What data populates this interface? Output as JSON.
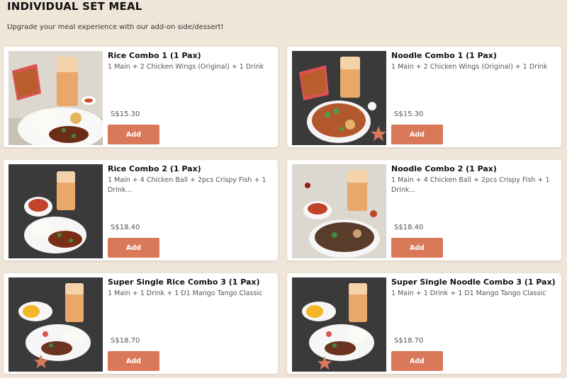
{
  "header": {
    "title": "INDIVIDUAL SET MEAL",
    "subtitle": "Upgrade your meal experience with our add-on side/dessert!"
  },
  "colors": {
    "background": "#efe6d9",
    "add_button": "#d9795a",
    "photo_dark_bg": "#3b3b3b"
  },
  "items": [
    {
      "name": "Rice Combo 1 (1 Pax)",
      "description": "1 Main + 2 Chicken Wings (Original) + 1 Drink",
      "price": "S$15.30",
      "button": "Add",
      "photo": "rice-combo-1-photo"
    },
    {
      "name": "Noodle Combo 1 (1 Pax)",
      "description": "1 Main + 2 Chicken Wings (Original) + 1 Drink",
      "price": "S$15.30",
      "button": "Add",
      "photo": "noodle-combo-1-photo"
    },
    {
      "name": "Rice Combo 2 (1 Pax)",
      "description": "1 Main + 4 Chicken Ball + 2pcs Crispy Fish + 1 Drink...",
      "price": "S$18.40",
      "button": "Add",
      "photo": "rice-combo-2-photo"
    },
    {
      "name": "Noodle Combo 2 (1 Pax)",
      "description": "1 Main + 4 Chicken Ball + 2pcs Crispy Fish + 1 Drink...",
      "price": "S$18.40",
      "button": "Add",
      "photo": "noodle-combo-2-photo"
    },
    {
      "name": "Super Single Rice Combo 3 (1 Pax)",
      "description": "1 Main + 1 Drink + 1 D1 Mango Tango Classic",
      "price": "S$18.70",
      "button": "Add",
      "photo": "super-single-rice-combo-3-photo"
    },
    {
      "name": "Super Single Noodle Combo 3 (1 Pax)",
      "description": "1 Main + 1 Drink + 1 D1 Mango Tango Classic",
      "price": "S$18.70",
      "button": "Add",
      "photo": "super-single-noodle-combo-3-photo"
    }
  ]
}
